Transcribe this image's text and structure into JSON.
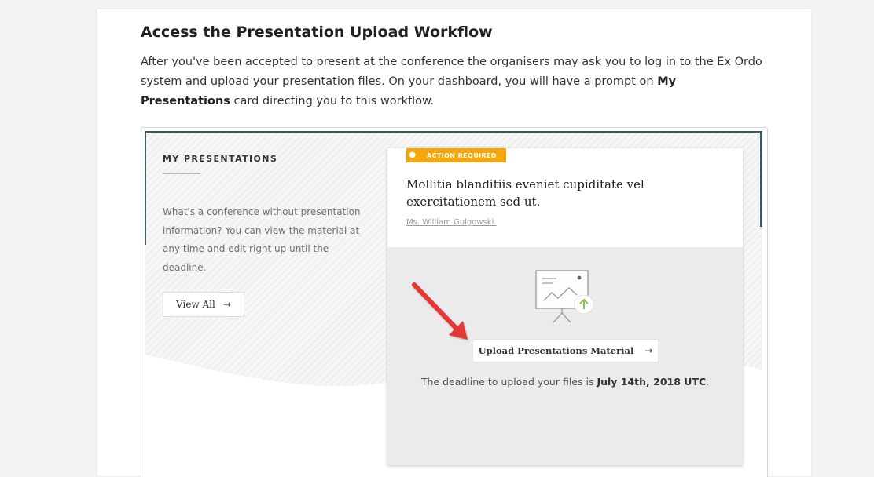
{
  "article": {
    "heading": "Access the Presentation Upload Workflow",
    "intro_part1": "After you've been accepted to present at the conference the organisers may ask you to log in to the Ex Ordo system and upload your presentation files. On your dashboard, you will have a prompt on ",
    "intro_bold": "My Presentations",
    "intro_part2": " card directing you to this workflow."
  },
  "panel": {
    "section_title": "MY PRESENTATIONS",
    "description": "What's a conference without presentation information? You can view the material at any time and edit right up until the deadline.",
    "view_all_label": "View All",
    "view_all_arrow": "→"
  },
  "card": {
    "badge_label": "ACTION REQUIRED",
    "badge_dot": "●",
    "title": "Mollitia blanditiis eveniet cupiditate vel exercitationem sed ut.",
    "author": "Ms. William Gulgowski",
    "author_suffix": ".",
    "upload_label": "Upload Presentations Material",
    "upload_arrow": "→",
    "deadline_prefix": "The deadline to upload your files is ",
    "deadline_date": "July 14th, 2018 UTC",
    "deadline_suffix": "."
  },
  "colors": {
    "badge": "#f5a70a",
    "upload_icon": "#8bc34a",
    "pointer_arrow": "#e53935",
    "frame_edge": "#3d5a6b"
  }
}
